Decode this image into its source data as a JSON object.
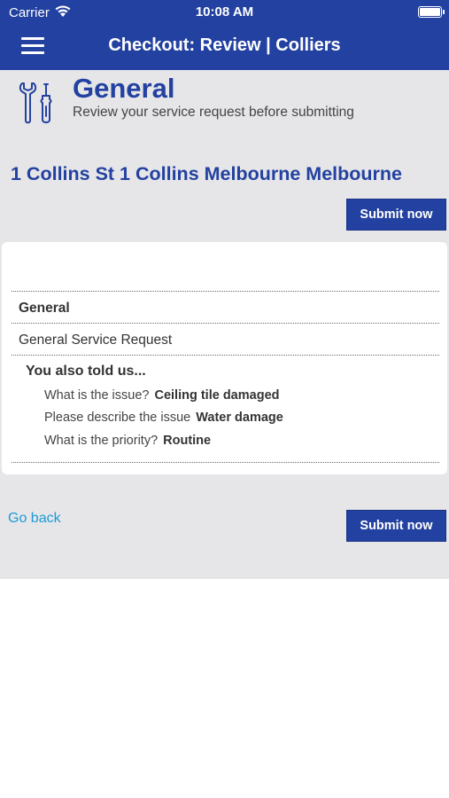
{
  "status_bar": {
    "carrier": "Carrier",
    "time": "10:08 AM"
  },
  "nav": {
    "title": "Checkout: Review | Colliers",
    "menu_icon": "hamburger-menu-icon"
  },
  "header": {
    "icon": "tools-icon",
    "title": "General",
    "subtitle": "Review your service request before submitting",
    "address": "1 Collins St 1 Collins Melbourne Melbourne",
    "submit_label": "Submit now"
  },
  "review": {
    "category": "General",
    "request_type": "General Service Request",
    "told_us_heading": "You also told us...",
    "answers": [
      {
        "question": "What is the issue?",
        "answer": "Ceiling tile damaged"
      },
      {
        "question": "Please describe the issue",
        "answer": "Water damage"
      },
      {
        "question": "What is the priority?",
        "answer": "Routine"
      }
    ]
  },
  "footer": {
    "go_back_label": "Go back",
    "submit_label": "Submit now"
  },
  "colors": {
    "brand_blue": "#2341a0",
    "link_blue": "#1e9ad6",
    "panel_grey": "#e6e6e8"
  }
}
